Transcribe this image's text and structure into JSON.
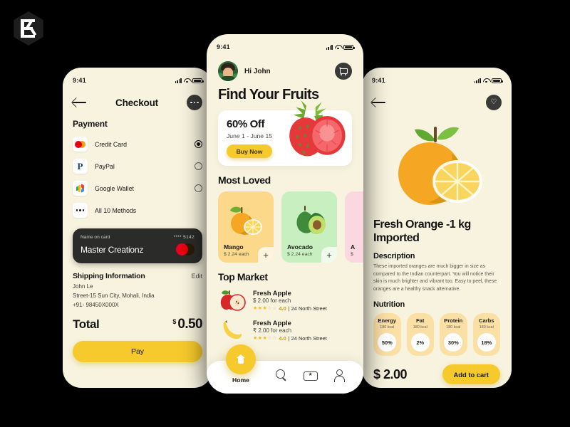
{
  "brand": {
    "logo_name": "kreatives-logo"
  },
  "checkout_screen": {
    "status": {
      "time": "9:41"
    },
    "header": {
      "back": "back-arrow",
      "title": "Checkout",
      "more": "more-options"
    },
    "payment": {
      "section_title": "Payment",
      "methods": [
        {
          "label": "Credit Card",
          "icon": "mastercard-icon",
          "selected": true
        },
        {
          "label": "PayPal",
          "icon": "paypal-icon",
          "selected": false
        },
        {
          "label": "Google Wallet",
          "icon": "google-wallet-icon",
          "selected": false
        },
        {
          "label": "All 10 Methods",
          "icon": "ellipsis-icon",
          "selected": false
        }
      ]
    },
    "card": {
      "name_label": "Name on card",
      "masked_number": "**** 5142",
      "holder": "Master Creationz",
      "brand_icon": "mastercard-icon"
    },
    "shipping": {
      "title": "Shipping Information",
      "edit": "Edit",
      "name": "John Le",
      "address": "Street-15 Sun City, Mohali, India",
      "phone": "+91- 98450X000X"
    },
    "total": {
      "label": "Total",
      "currency": "$",
      "amount": "0.50"
    },
    "pay_button": "Pay"
  },
  "home_screen": {
    "status": {
      "time": "9:41"
    },
    "greeting": "Hi John",
    "cart_icon": "shopping-cart-icon",
    "title": "Find Your Fruits",
    "promo": {
      "title": "60% Off",
      "dates": "June 1 - June 15",
      "button": "Buy Now",
      "art": "strawberry-illustration"
    },
    "most_loved": {
      "section_title": "Most Loved",
      "cards": [
        {
          "name": "Mango",
          "price": "$ 2.24 each",
          "bg": "#FBD88A",
          "art": "mango-illustration",
          "add": "+"
        },
        {
          "name": "Avocado",
          "price": "$ 2.24 each",
          "bg": "#C8EFC0",
          "art": "avocado-illustration",
          "add": "+"
        },
        {
          "name": "A",
          "price": "$",
          "bg": "#FBD7DF",
          "art": "apple-illustration",
          "add": "+"
        }
      ]
    },
    "top_market": {
      "section_title": "Top Market",
      "items": [
        {
          "name": "Fresh Apple",
          "price": "$ 2.00 for each",
          "rating": "4.0",
          "stars_on": 3,
          "stars_off": 2,
          "address": "24 North Street",
          "art": "apple-illustration"
        },
        {
          "name": "Fresh Apple",
          "price": "₹ 2.00 for each",
          "rating": "4.0",
          "stars_on": 3,
          "stars_off": 2,
          "address": "24 North Street",
          "art": "banana-illustration"
        }
      ]
    },
    "nav": [
      {
        "label": "Home",
        "icon": "home-icon",
        "active": true
      },
      {
        "label": "",
        "icon": "search-icon",
        "active": false
      },
      {
        "label": "",
        "icon": "ticket-icon",
        "active": false
      },
      {
        "label": "",
        "icon": "profile-icon",
        "active": false
      }
    ]
  },
  "detail_screen": {
    "status": {
      "time": "9:41"
    },
    "back": "back-arrow",
    "favorite_icon": "heart-icon",
    "art": "orange-illustration",
    "title": "Fresh Orange -1 kg Imported",
    "description_title": "Description",
    "description": "These imported oranges are much bigger in size as compared to the Indian counterpart. You will notice their skin is much brighter and vibrant too. Easy to peel, these oranges are a healthy snack alternative.",
    "nutrition_title": "Nutrition",
    "nutrition": [
      {
        "name": "Energy",
        "kcal": "180 kcal",
        "percent": "50%"
      },
      {
        "name": "Fat",
        "kcal": "180 kcal",
        "percent": "2%"
      },
      {
        "name": "Protein",
        "kcal": "180 kcal",
        "percent": "30%"
      },
      {
        "name": "Carbs",
        "kcal": "180 kcal",
        "percent": "18%"
      }
    ],
    "price": "$ 2.00",
    "add_to_cart": "Add to cart"
  },
  "colors": {
    "background": "#000000",
    "screen_bg": "#F7F3DE",
    "accent_yellow": "#F6C92C",
    "dark": "#2B2B29",
    "white": "#FFFFFF"
  }
}
